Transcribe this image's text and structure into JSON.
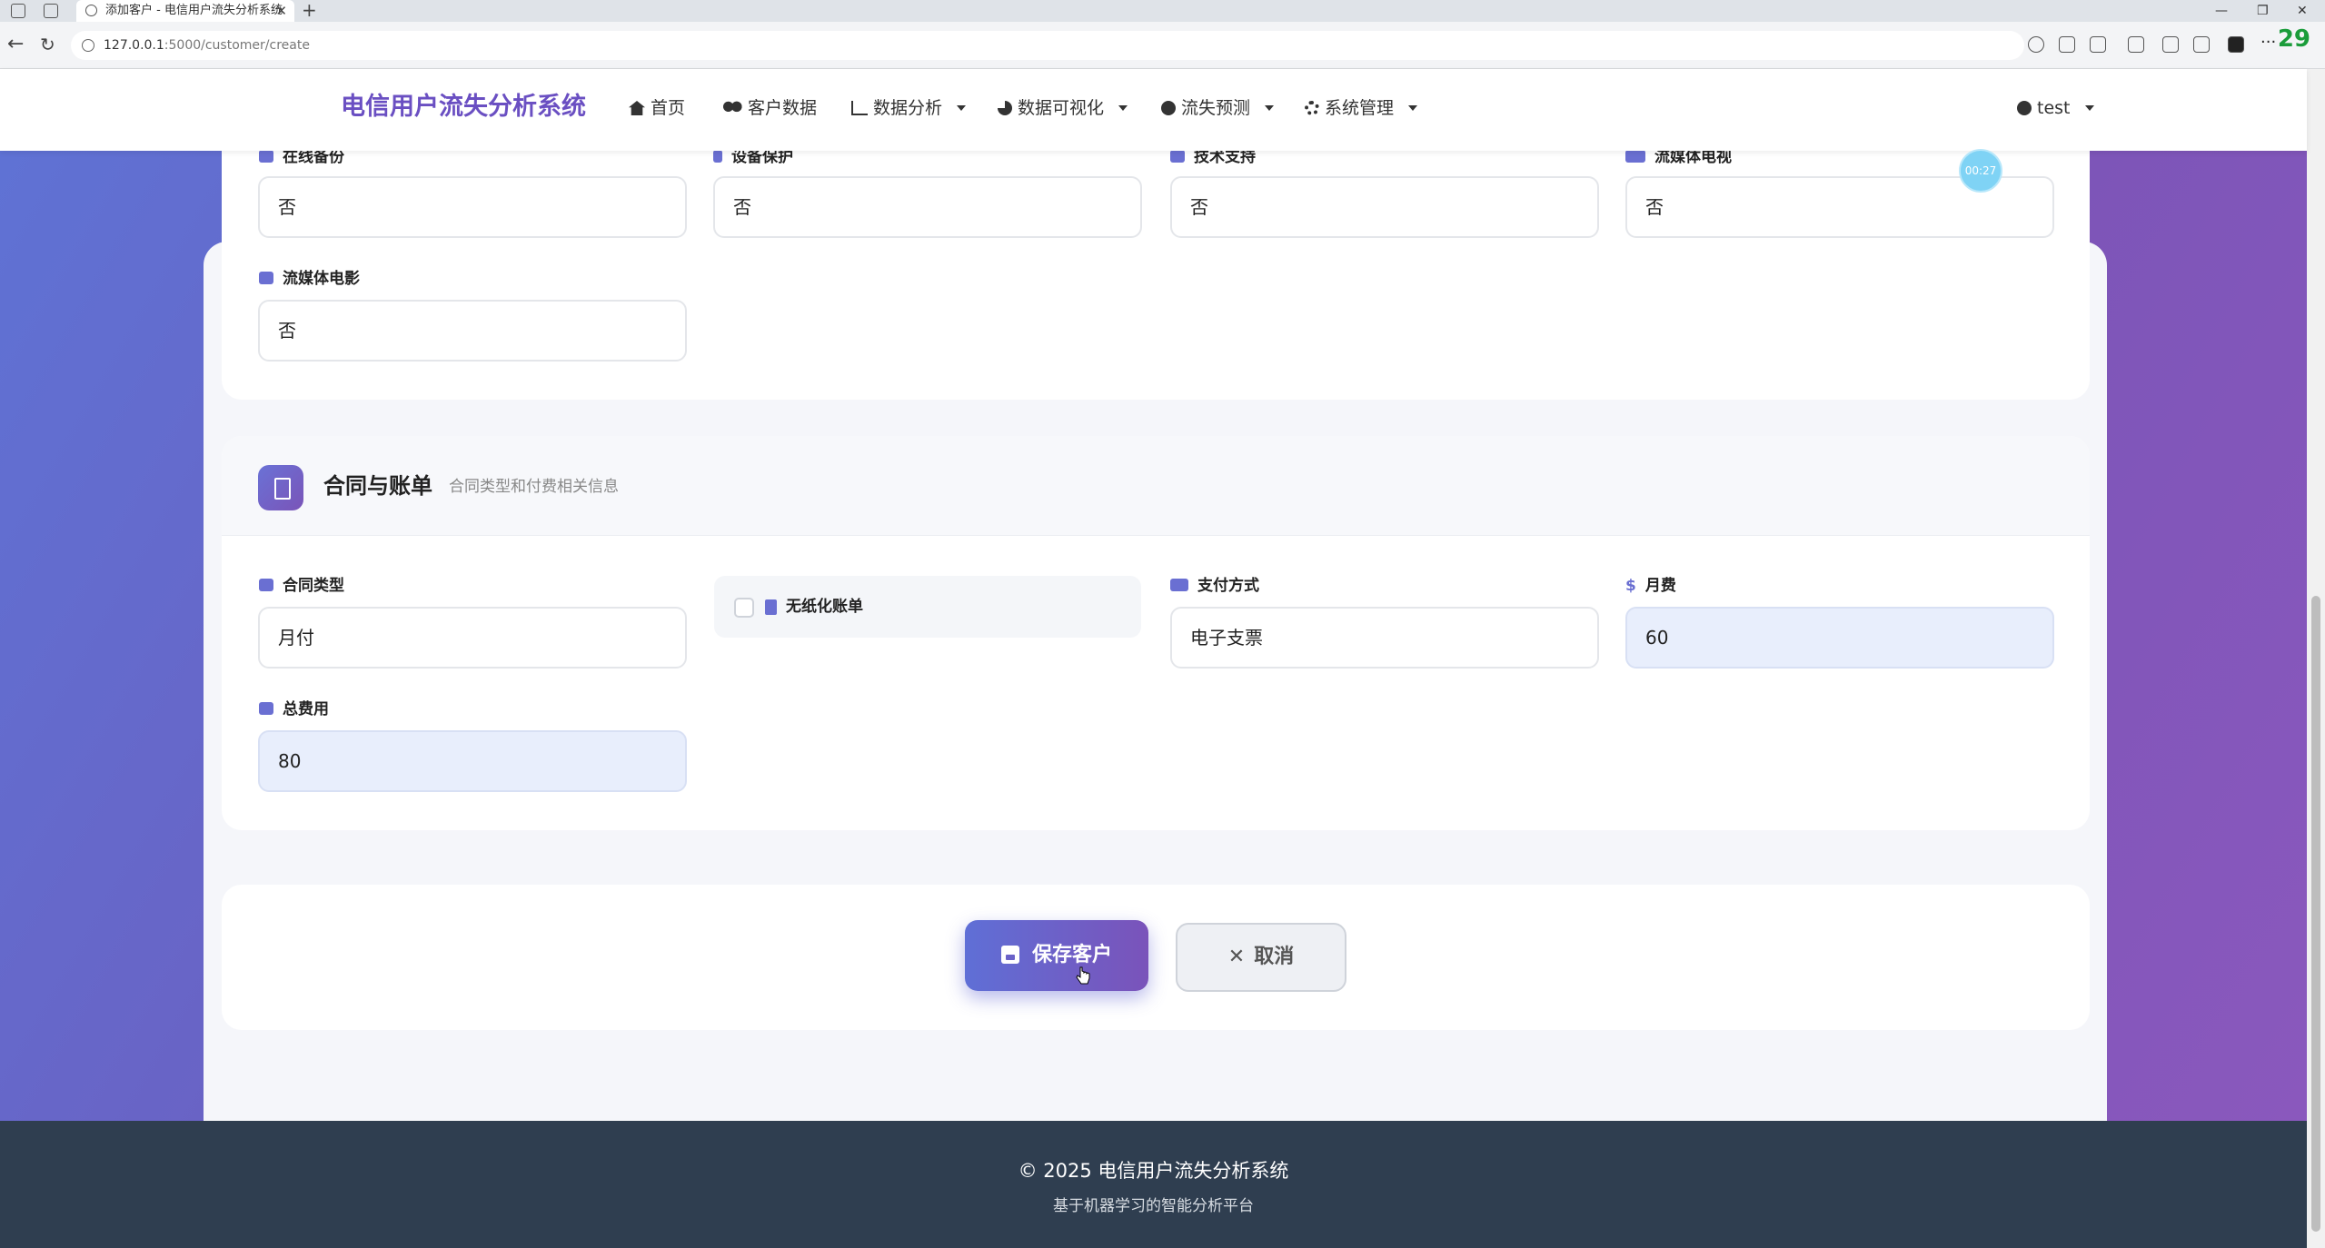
{
  "browser": {
    "tab_title": "添加客户 - 电信用户流失分析系统",
    "tab_close": "✕",
    "new_tab": "+",
    "url_host": "127.0.0.1",
    "url_path": ":5000/customer/create",
    "badge": "29",
    "win_min": "—",
    "win_restore": "❐",
    "win_close": "✕"
  },
  "nav": {
    "brand": "电信用户流失分析系统",
    "items": [
      {
        "label": "首页",
        "icon": "home-icon",
        "dropdown": false
      },
      {
        "label": "客户数据",
        "icon": "users-icon",
        "dropdown": false
      },
      {
        "label": "数据分析",
        "icon": "chart-bar-icon",
        "dropdown": true
      },
      {
        "label": "数据可视化",
        "icon": "chart-pie-icon",
        "dropdown": true
      },
      {
        "label": "流失预测",
        "icon": "brain-icon",
        "dropdown": true
      },
      {
        "label": "系统管理",
        "icon": "gear-icon",
        "dropdown": true
      }
    ],
    "user": "test"
  },
  "services": {
    "online_backup": {
      "label": "在线备份",
      "value": "否"
    },
    "device_protection": {
      "label": "设备保护",
      "value": "否"
    },
    "tech_support": {
      "label": "技术支持",
      "value": "否"
    },
    "streaming_tv": {
      "label": "流媒体电视",
      "value": "否"
    },
    "streaming_movies": {
      "label": "流媒体电影",
      "value": "否"
    }
  },
  "contract": {
    "title": "合同与账单",
    "subtitle": "合同类型和付费相关信息",
    "contract_type": {
      "label": "合同类型",
      "value": "月付"
    },
    "paperless": {
      "label": "无纸化账单",
      "checked": false
    },
    "payment_method": {
      "label": "支付方式",
      "value": "电子支票"
    },
    "monthly_fee": {
      "label": "月费",
      "value": "60"
    },
    "total_fee": {
      "label": "总费用",
      "value": "80"
    }
  },
  "actions": {
    "save": "保存客户",
    "cancel": "取消",
    "cancel_icon": "✕"
  },
  "timer": "00:27",
  "footer": {
    "copyright": "© 2025 电信用户流失分析系统",
    "tagline": "基于机器学习的智能分析平台"
  },
  "colors": {
    "brand": "#6a4fc2",
    "accent_from": "#5f72d4",
    "accent_to": "#8a58bd",
    "footer": "#2f3e50"
  }
}
